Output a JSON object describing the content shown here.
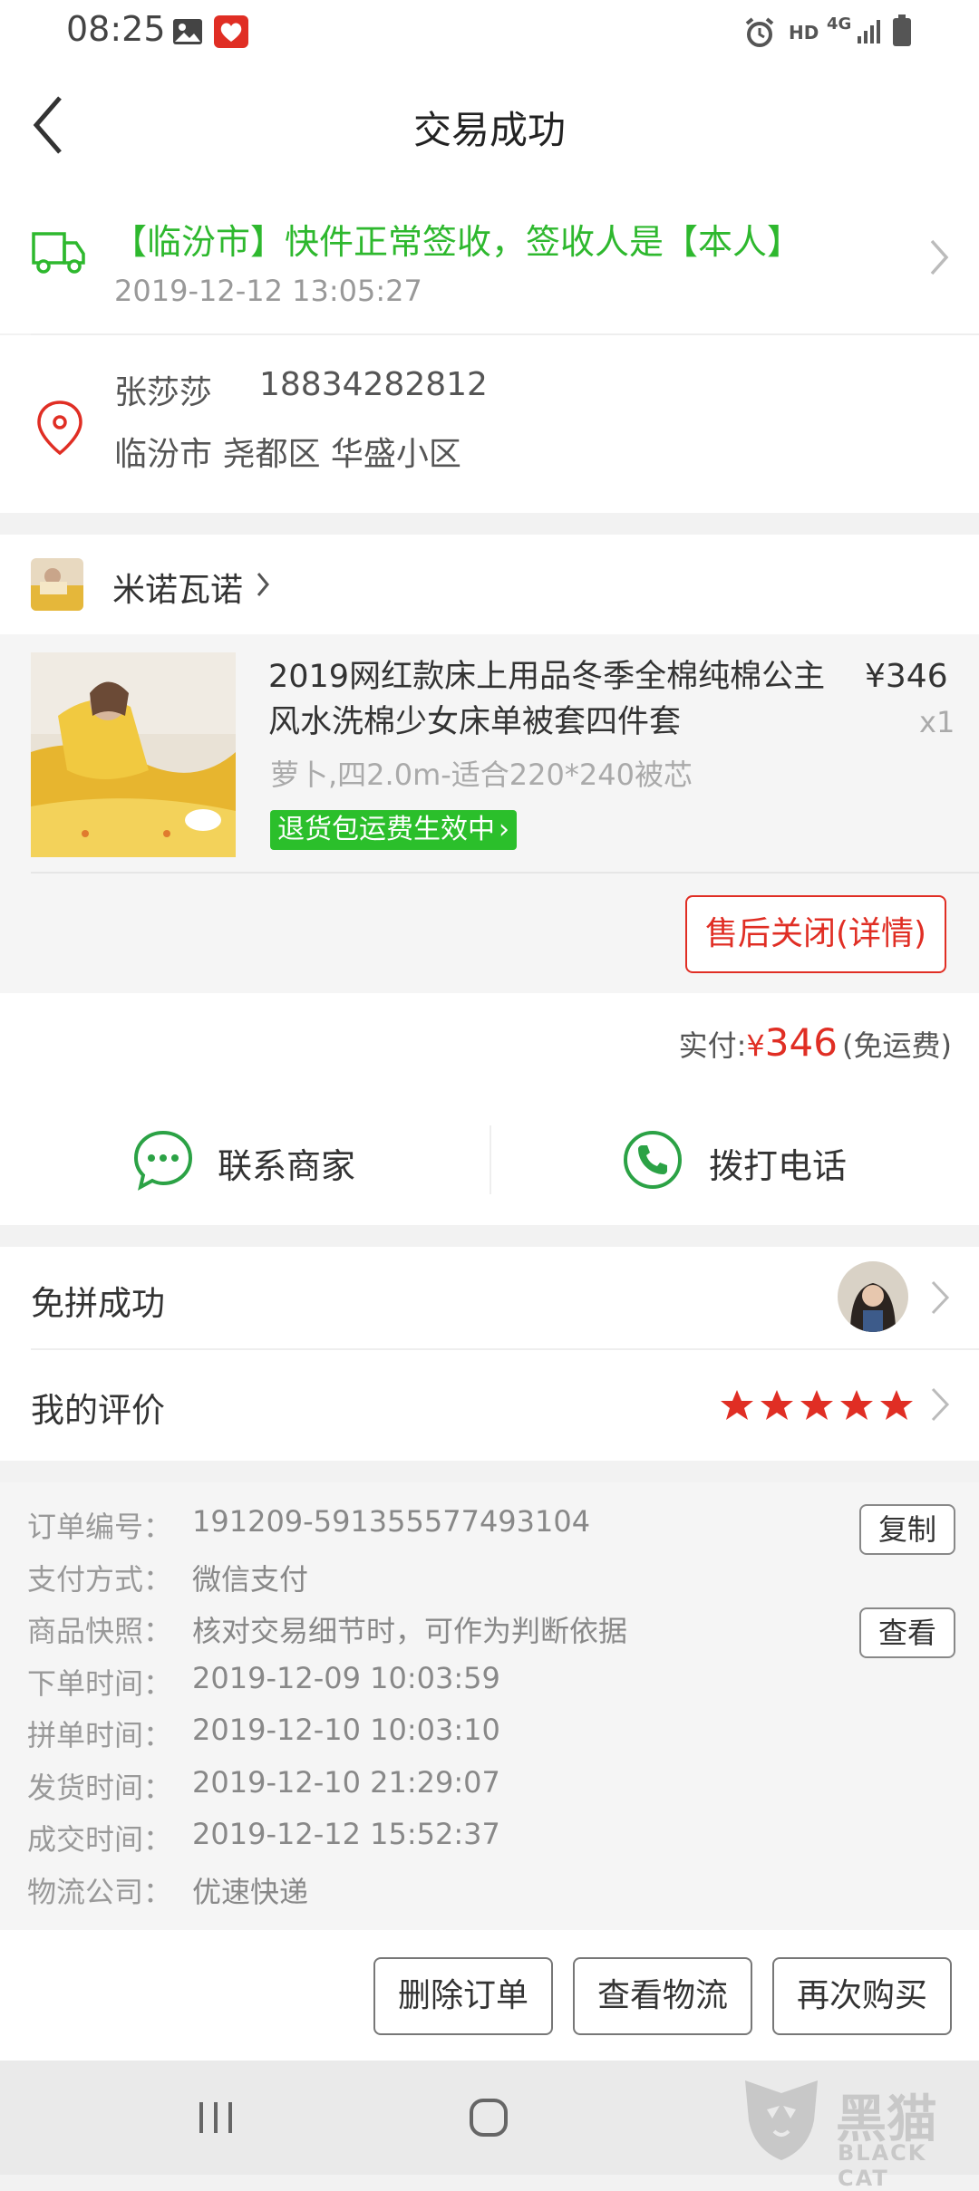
{
  "status_bar": {
    "time": "08:25",
    "icons_left": [
      "image-icon",
      "app-heart-icon"
    ],
    "icons_right": [
      "alarm-icon",
      "hd-icon",
      "4g-icon",
      "signal-icon",
      "battery-icon"
    ],
    "hd": "HD",
    "network": "4G"
  },
  "header": {
    "title": "交易成功"
  },
  "logistics": {
    "message": "【临汾市】快件正常签收，签收人是【本人】",
    "time": "2019-12-12 13:05:27"
  },
  "address": {
    "name": "张莎莎",
    "phone": "18834282812",
    "detail": "临汾市 尧都区 华盛小区"
  },
  "shop": {
    "name": "米诺瓦诺"
  },
  "product": {
    "title": "2019网红款床上用品冬季全棉纯棉公主风水洗棉少女床单被套四件套",
    "price": "¥346",
    "quantity": "x1",
    "spec": "萝卜,四2.0m-适合220*240被芯",
    "return_tag": "退货包运费生效中",
    "aftersale_button": "售后关闭(详情)"
  },
  "payment": {
    "label": "实付:",
    "currency": "¥",
    "amount": "346",
    "note": "(免运费)"
  },
  "contact": {
    "merchant": "联系商家",
    "phone": "拨打电话"
  },
  "group": {
    "label": "免拼成功"
  },
  "review": {
    "label": "我的评价",
    "stars": 5
  },
  "order_info": {
    "rows": [
      {
        "label": "订单编号：",
        "value": "191209-591355577493104"
      },
      {
        "label": "支付方式：",
        "value": "微信支付"
      },
      {
        "label": "商品快照：",
        "value": "核对交易细节时，可作为判断依据"
      },
      {
        "label": "下单时间：",
        "value": "2019-12-09 10:03:59"
      },
      {
        "label": "拼单时间：",
        "value": "2019-12-10 10:03:10"
      },
      {
        "label": "发货时间：",
        "value": "2019-12-10 21:29:07"
      },
      {
        "label": "成交时间：",
        "value": "2019-12-12 15:52:37"
      },
      {
        "label": "物流公司：",
        "value": "优速快递"
      }
    ],
    "copy_button": "复制",
    "view_button": "查看"
  },
  "actions": {
    "delete": "删除订单",
    "logistics": "查看物流",
    "rebuy": "再次购买"
  },
  "watermark": {
    "brand": "黑猫",
    "brand_en": "BLACK CAT"
  },
  "colors": {
    "green": "#2eb82e",
    "red": "#e02e24",
    "wechat_green": "#2ba245"
  }
}
